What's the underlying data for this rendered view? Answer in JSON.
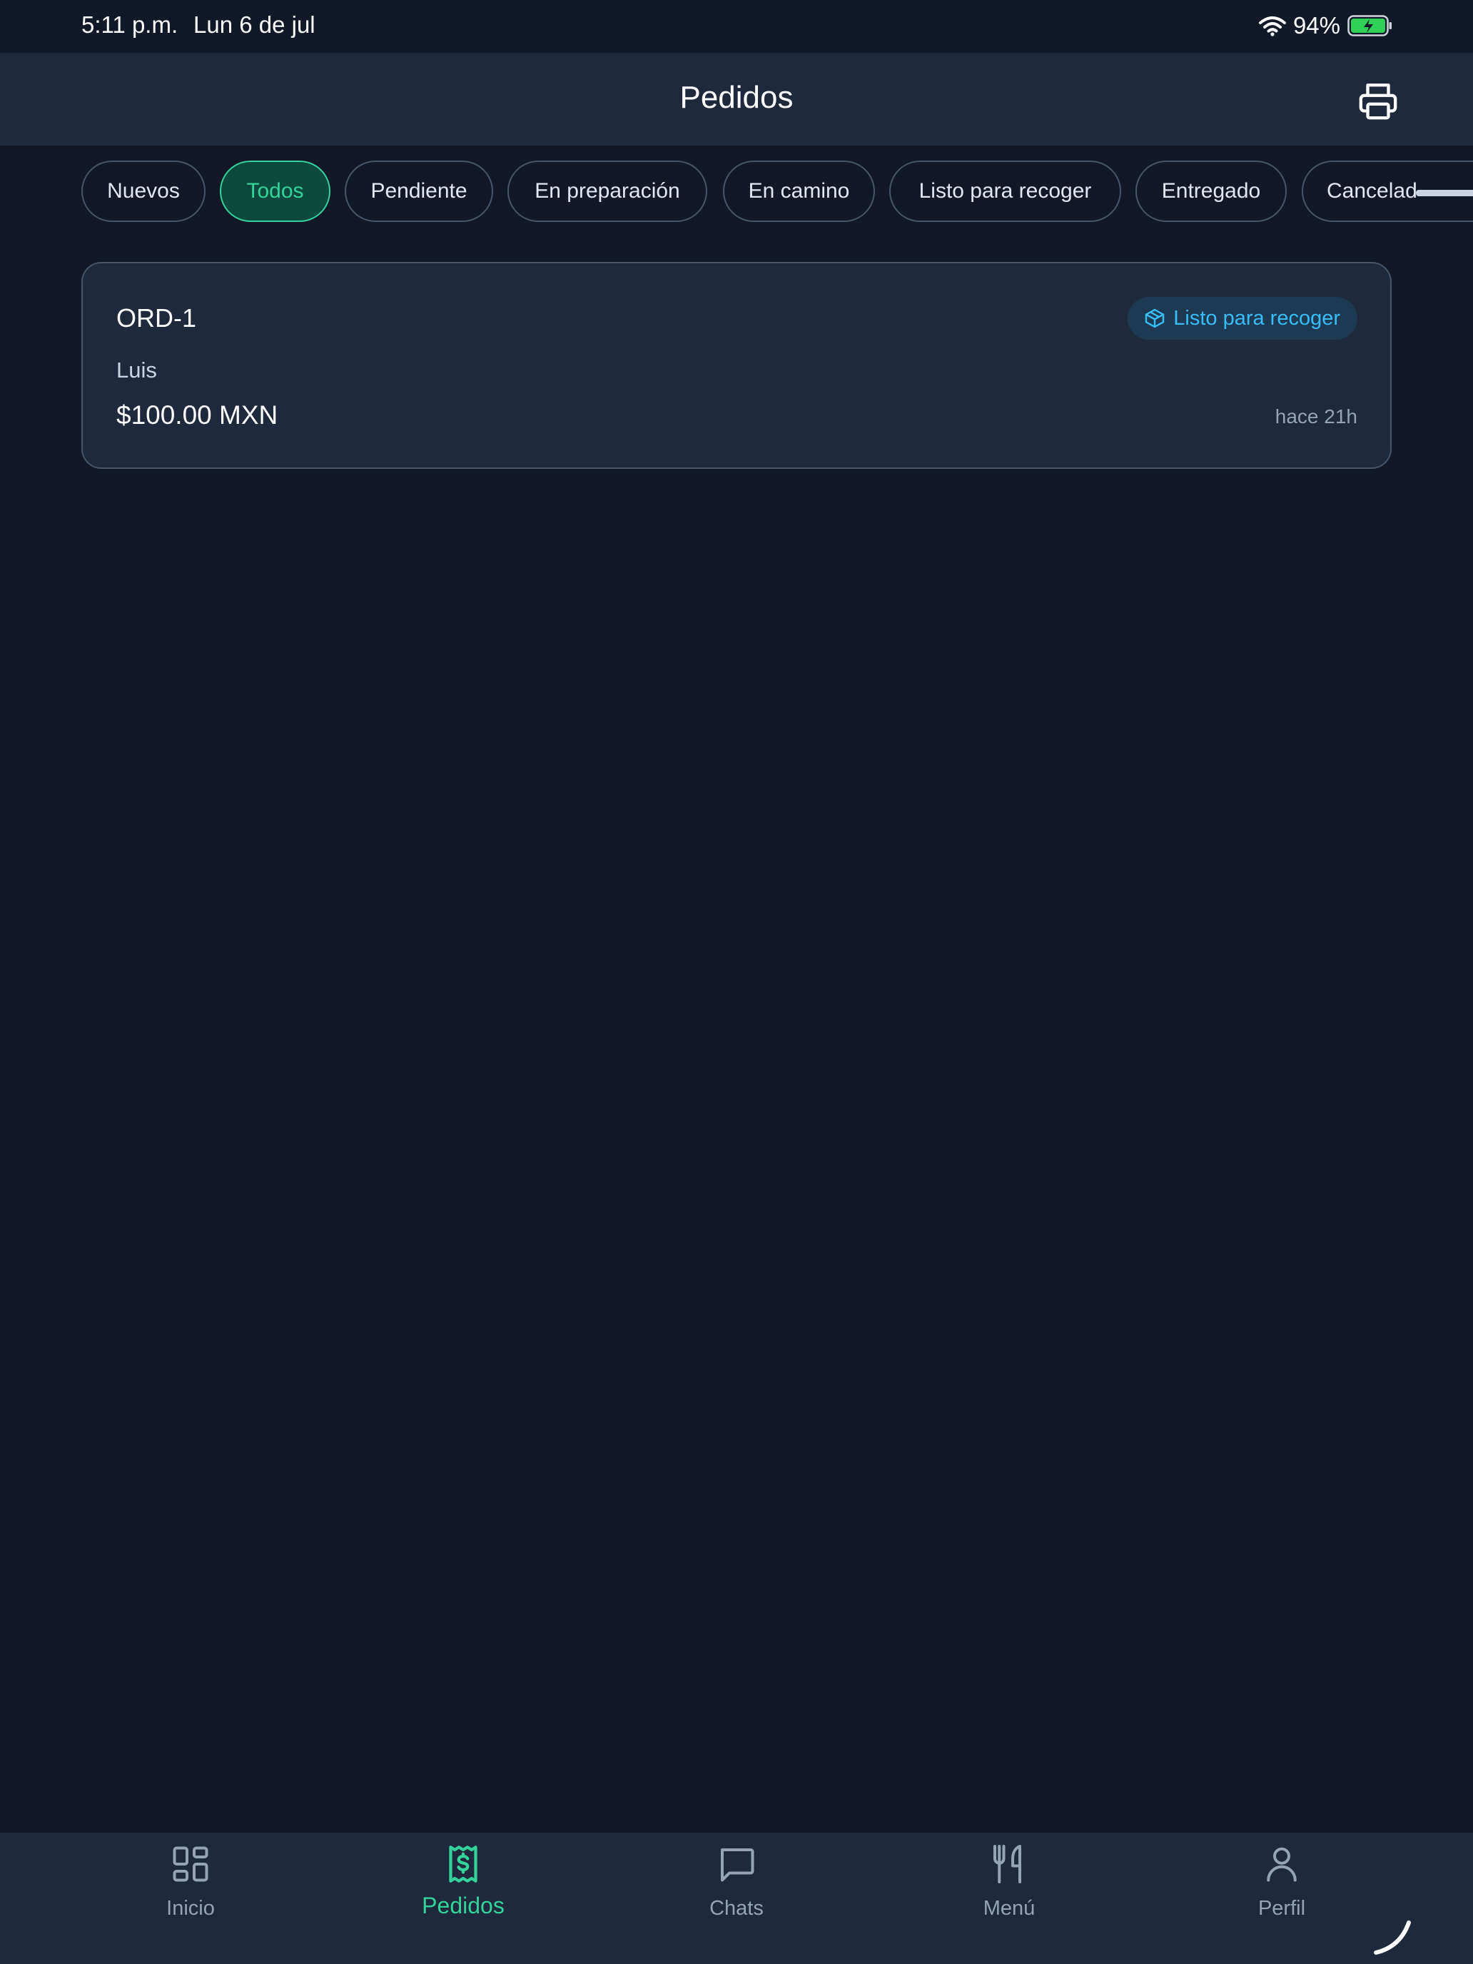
{
  "status_bar": {
    "time": "5:11 p.m.",
    "date": "Lun 6 de jul",
    "battery": "94%",
    "wifi_icon": "wifi-icon",
    "battery_icon": "battery-charging-icon"
  },
  "header": {
    "title": "Pedidos",
    "print_icon": "printer-icon"
  },
  "filters": [
    {
      "label": "Nuevos",
      "active": false
    },
    {
      "label": "Todos",
      "active": true
    },
    {
      "label": "Pendiente",
      "active": false
    },
    {
      "label": "En preparación",
      "active": false
    },
    {
      "label": "En camino",
      "active": false
    },
    {
      "label": "Listo para recoger",
      "active": false
    },
    {
      "label": "Entregado",
      "active": false
    },
    {
      "label": "Cancelad",
      "active": false
    }
  ],
  "orders": [
    {
      "id": "ORD-1",
      "customer": "Luis",
      "amount": "$100.00 MXN",
      "status": "Listo para recoger",
      "status_icon": "package-icon",
      "elapsed": "hace 21h"
    }
  ],
  "nav": [
    {
      "label": "Inicio",
      "icon": "grid-icon",
      "active": false
    },
    {
      "label": "Pedidos",
      "icon": "receipt-icon",
      "active": true
    },
    {
      "label": "Chats",
      "icon": "chat-icon",
      "active": false
    },
    {
      "label": "Menú",
      "icon": "utensils-icon",
      "active": false
    },
    {
      "label": "Perfil",
      "icon": "user-icon",
      "active": false
    }
  ],
  "colors": {
    "background": "#121826",
    "surface": "#1e293b",
    "accent": "#34d399",
    "badge_text": "#38bdf8",
    "muted": "#94a3b8"
  }
}
